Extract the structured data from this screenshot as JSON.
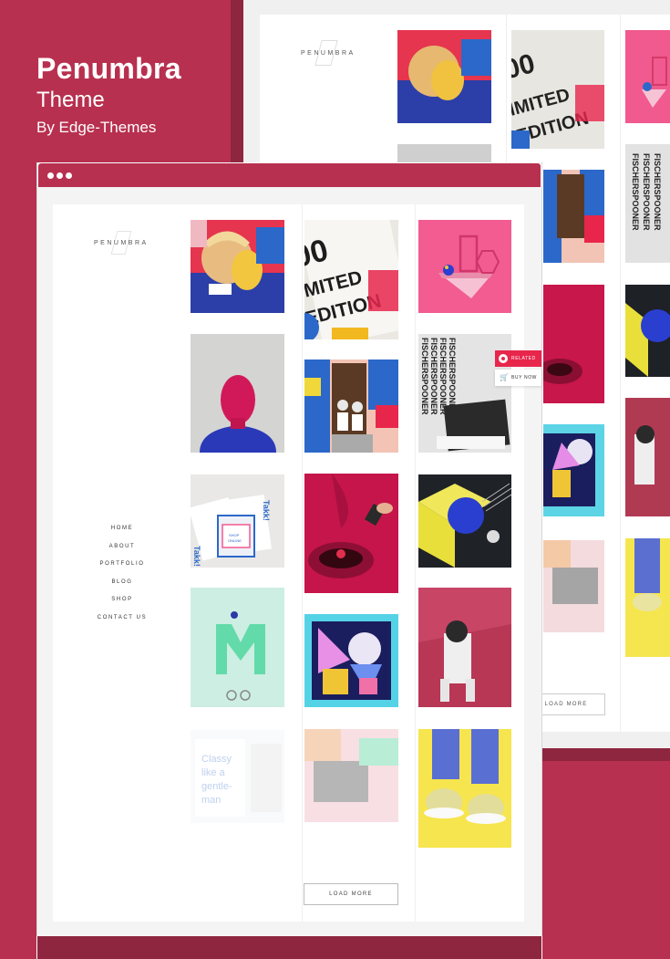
{
  "promo": {
    "title": "Penumbra",
    "subtitle": "Theme",
    "byline": "By Edge-Themes"
  },
  "back_page": {
    "logo": "PENUMBRA",
    "load_more": "LOAD MORE"
  },
  "front_page": {
    "logo": "PENUMBRA",
    "menu": [
      "HOME",
      "ABOUT",
      "PORTFOLIO",
      "BLOG",
      "SHOP",
      "CONTACT US"
    ],
    "load_more": "LOAD MORE",
    "float_related": "RELATED",
    "float_buy": "BUY NOW",
    "poster_text": "LIMITED EDITION",
    "poster_number": "00",
    "book_text": "FISCHERSPOONER",
    "card_text": "Takk!",
    "card_sub": "SHOP ONLINE",
    "cover_text": "Classy like a gentle-man"
  },
  "colors": {
    "brand": "#b8304f",
    "brand_dark": "#8e2640",
    "accent": "#e8264c"
  }
}
